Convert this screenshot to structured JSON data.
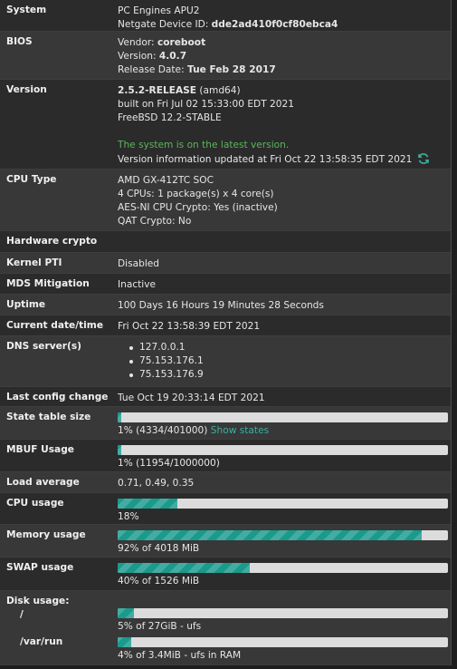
{
  "system": {
    "label": "System",
    "name": "PC Engines APU2",
    "device_id_prefix": "Netgate Device ID: ",
    "device_id": "dde2ad410f0cf80ebca4"
  },
  "bios": {
    "label": "BIOS",
    "vendor_prefix": "Vendor: ",
    "vendor": "coreboot",
    "version_prefix": "Version: ",
    "version": "4.0.7",
    "date_prefix": "Release Date: ",
    "date": "Tue Feb 28 2017"
  },
  "version": {
    "label": "Version",
    "release": "2.5.2-RELEASE",
    "arch": " (amd64)",
    "built": "built on Fri Jul 02 15:33:00 EDT 2021",
    "os": "FreeBSD 12.2-STABLE",
    "status": "The system is on the latest version.",
    "updated": "Version information updated at Fri Oct 22 13:58:35 EDT 2021",
    "refresh_icon": "refresh-icon"
  },
  "cpu_type": {
    "label": "CPU Type",
    "model": "AMD GX-412TC SOC",
    "cores": "4 CPUs: 1 package(s) x 4 core(s)",
    "aesni": "AES-NI CPU Crypto: Yes (inactive)",
    "qat": "QAT Crypto: No"
  },
  "hw_crypto": {
    "label": "Hardware crypto",
    "value": ""
  },
  "kernel_pti": {
    "label": "Kernel PTI",
    "value": "Disabled"
  },
  "mds": {
    "label": "MDS Mitigation",
    "value": "Inactive"
  },
  "uptime": {
    "label": "Uptime",
    "value": "100 Days 16 Hours 19 Minutes 28 Seconds"
  },
  "datetime": {
    "label": "Current date/time",
    "value": "Fri Oct 22 13:58:39 EDT 2021"
  },
  "dns": {
    "label": "DNS server(s)",
    "servers": [
      "127.0.0.1",
      "75.153.176.1",
      "75.153.176.9"
    ]
  },
  "last_config": {
    "label": "Last config change",
    "value": "Tue Oct 19 20:33:14 EDT 2021"
  },
  "state_table": {
    "label": "State table size",
    "text": "1% (4334/401000)",
    "link": "Show states",
    "percent": 1
  },
  "mbuf": {
    "label": "MBUF Usage",
    "text": "1% (11954/1000000)",
    "percent": 1
  },
  "load": {
    "label": "Load average",
    "value": "0.71, 0.49, 0.35"
  },
  "cpu_usage": {
    "label": "CPU usage",
    "text": "18%",
    "percent": 18
  },
  "memory": {
    "label": "Memory usage",
    "text": "92% of 4018 MiB",
    "percent": 92
  },
  "swap": {
    "label": "SWAP usage",
    "text": "40% of 1526 MiB",
    "percent": 40
  },
  "disk": {
    "label": "Disk usage:",
    "root": {
      "label": "/",
      "text": "5% of 27GiB - ufs",
      "percent": 5
    },
    "varrun": {
      "label": "/var/run",
      "text": "4% of 3.4MiB - ufs in RAM",
      "percent": 4
    }
  },
  "colors": {
    "bar_fill": "#1a9a8c",
    "bar_track": "#dcdcdc",
    "status_green": "#5bb55b",
    "link": "#3bb0a0"
  }
}
